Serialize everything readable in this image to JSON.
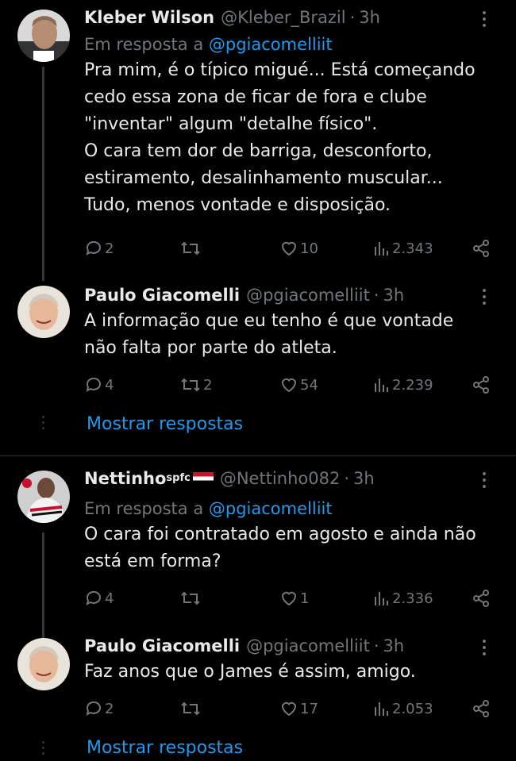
{
  "tweets": [
    {
      "name": "Kleber Wilson",
      "handle": "@Kleber_Brazil",
      "time": "3h",
      "reply_prefix": "Em resposta a",
      "reply_handle": "@pgiacomelliit",
      "text": "Pra mim, é o típico migué... Está começando\ncedo essa zona de ficar de fora e clube\n\"inventar\" algum \"detalhe físico\".\nO cara tem dor de barriga, desconforto,\nestiramento, desalinhamento muscular...\nTudo, menos vontade e disposição.",
      "replies": "2",
      "retweets": "",
      "likes": "10",
      "views": "2.343"
    },
    {
      "name": "Paulo Giacomelli",
      "handle": "@pgiacomelliit",
      "time": "3h",
      "text": "A informação que eu tenho é que vontade\nnão falta por parte do atleta.",
      "replies": "4",
      "retweets": "2",
      "likes": "54",
      "views": "2.239"
    },
    {
      "name": "Nettinho",
      "name_suffix": "spfc",
      "handle": "@Nettinho082",
      "time": "3h",
      "reply_prefix": "Em resposta a",
      "reply_handle": "@pgiacomelliit",
      "text": "O cara foi contratado em agosto e ainda não\nestá em forma?",
      "replies": "4",
      "retweets": "",
      "likes": "1",
      "views": "2.336"
    },
    {
      "name": "Paulo Giacomelli",
      "handle": "@pgiacomelliit",
      "time": "3h",
      "text": "Faz anos que o James é assim, amigo.",
      "replies": "2",
      "retweets": "",
      "likes": "17",
      "views": "2.053"
    }
  ],
  "show_replies_label": "Mostrar respostas",
  "dot": "·",
  "colors": {
    "background": "#000000",
    "text": "#e7e9ea",
    "muted": "#71767b",
    "link": "#1d9bf0",
    "divider": "#2f3336"
  }
}
